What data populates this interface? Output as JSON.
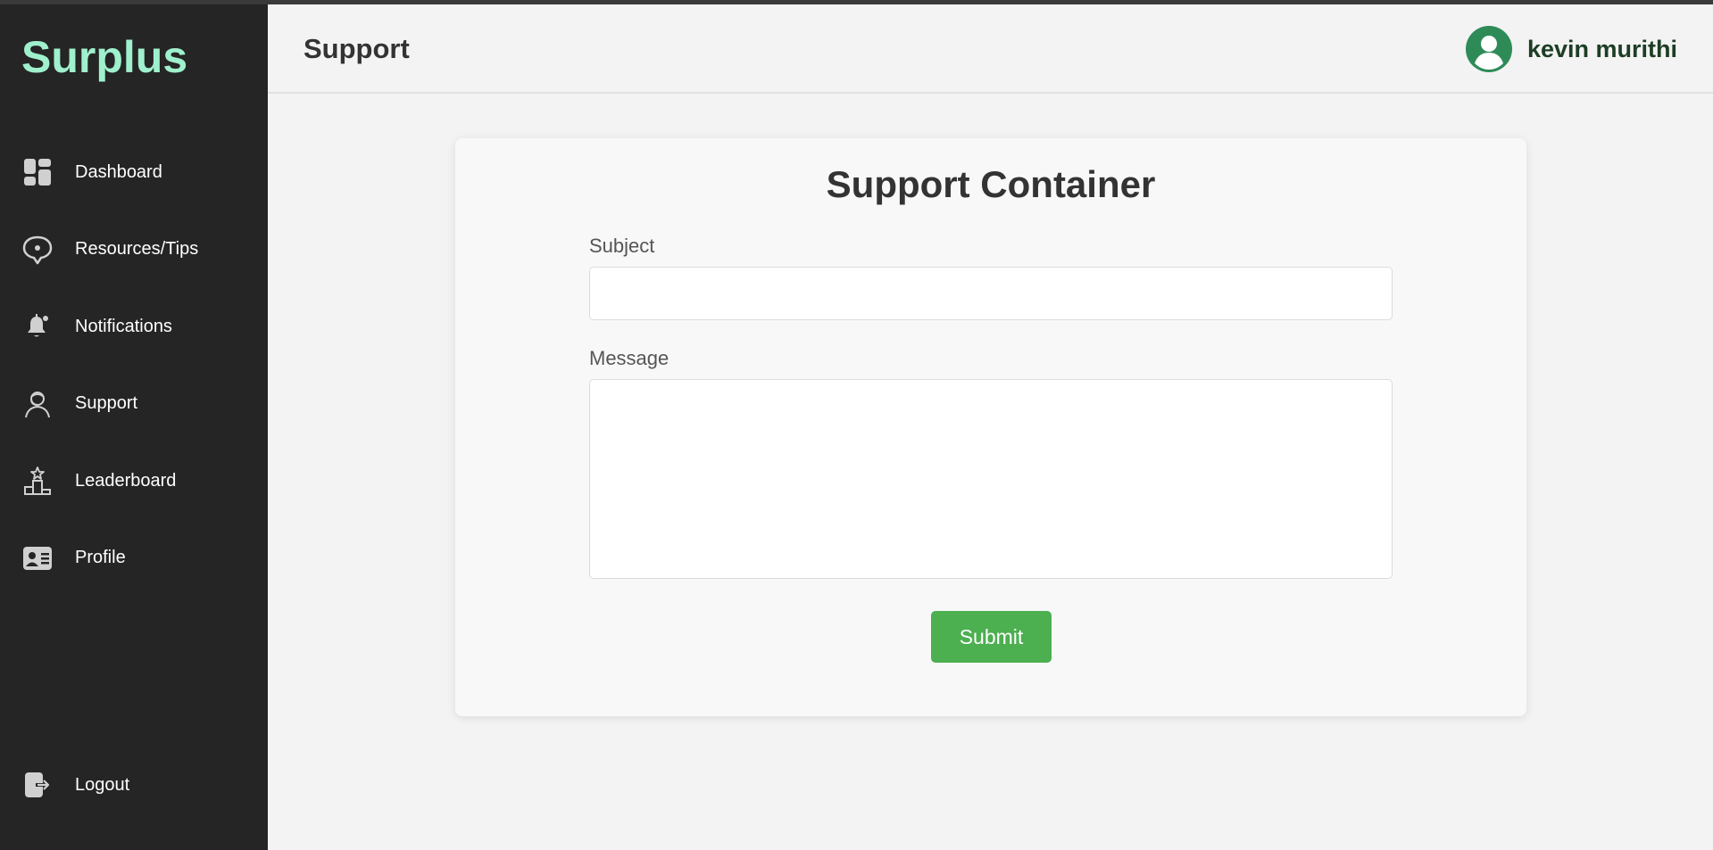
{
  "app": {
    "brand": "Surplus"
  },
  "sidebar": {
    "items": [
      {
        "label": "Dashboard",
        "icon": "dashboard-icon"
      },
      {
        "label": "Resources/Tips",
        "icon": "chat-tip-icon"
      },
      {
        "label": "Notifications",
        "icon": "bell-icon"
      },
      {
        "label": "Support",
        "icon": "support-agent-icon"
      },
      {
        "label": "Leaderboard",
        "icon": "podium-icon"
      },
      {
        "label": "Profile",
        "icon": "id-card-icon"
      }
    ],
    "logout": {
      "label": "Logout",
      "icon": "logout-icon"
    }
  },
  "header": {
    "title": "Support",
    "user": {
      "name": "kevin murithi",
      "icon": "user-avatar-icon"
    }
  },
  "form": {
    "title": "Support Container",
    "subject_label": "Subject",
    "subject_value": "",
    "message_label": "Message",
    "message_value": "",
    "submit_label": "Submit"
  },
  "colors": {
    "brand": "#9ff0cd",
    "sidebar_bg": "#252525",
    "accent": "#4caf50",
    "avatar": "#2e8b57"
  }
}
